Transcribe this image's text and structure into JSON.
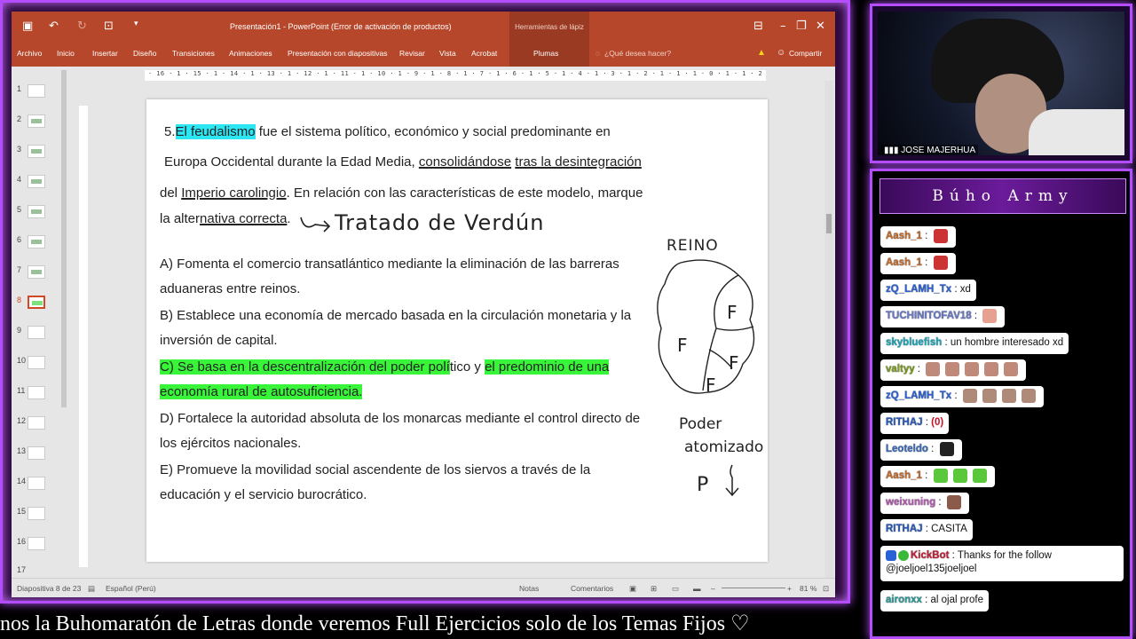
{
  "ppt": {
    "title": "Presentación1 - PowerPoint (Error de activación de productos)",
    "tools_header": "Herramientas de lápiz",
    "tabs": [
      "Archivo",
      "Inicio",
      "Insertar",
      "Diseño",
      "Transiciones",
      "Animaciones",
      "Presentación con diapositivas",
      "Revisar",
      "Vista",
      "Acrobat"
    ],
    "plumas_tab": "Plumas",
    "tell_me": "¿Qué desea hacer?",
    "share": "Compartir",
    "ruler": "· 16 · 1 · 15 · 1 · 14 · 1 · 13 · 1 · 12 · 1 · 11 · 1 · 10 · 1 · 9 · 1 · 8 · 1 · 7 · 1 · 6 · 1 · 5 · 1 · 4 · 1 · 3 · 1 · 2 · 1 · 1 · 1 · 0 · 1 · 1 · 2 · 1 · 3 · 1 · 4 · 1 · 5 · 1 · 6 · 1 · 7 · 1 · 8 · 1 · 9 · 1 · 10 · 1 · 11 · 1 · 12 · 1 · 13 · 1 · 14 · 1 · 15 · 1 · 16 ·",
    "thumbnails": [
      "1",
      "2",
      "3",
      "4",
      "5",
      "6",
      "7",
      "8",
      "9",
      "10",
      "11",
      "12",
      "13",
      "14",
      "15",
      "16",
      "17"
    ],
    "selected_slide": "8",
    "status": {
      "slide": "Diapositiva 8 de 23",
      "lang": "Español (Perú)",
      "notes": "Notas",
      "comments": "Comentarios",
      "zoom": "81 %"
    }
  },
  "slide": {
    "q_num": "5.",
    "q1_hl": "El feudalismo",
    "q1_rest": " fue el sistema político, económico y social predominante en",
    "q2a": "Europa Occidental durante la Edad Media, ",
    "q2b": "consolidándose",
    "q2c": " ",
    "q2d": "tras la desintegración",
    "q3a": "del ",
    "q3b": "Imperio carolingio",
    "q3c": ". En relación con las características de este modelo, marque",
    "q4a": "la alter",
    "q4b": "nativa correcta",
    "q4c": ".",
    "optA1": "A) Fomenta el comercio transatlántico mediante la eliminación de las barreras",
    "optA2": "aduaneras entre reinos.",
    "optB1": "B) Establece una economía de mercado basada en la circulación monetaria y la",
    "optB2": "inversión de capital.",
    "optC1a": "C) Se basa en la descentralización del poder polí",
    "optC1b": "tico y ",
    "optC1c": "el predominio de una",
    "optC2": "economía rural de autosuficiencia.",
    "optD1": "D) Fortalece la autoridad absoluta de los monarcas mediante el control directo de",
    "optD2": "los ejércitos nacionales.",
    "optE1": "E) Promueve la movilidad social ascendente de los siervos a través de la",
    "optE2": "educación y el servicio burocrático.",
    "hand_tratado": "Tratado de Verdún",
    "hand_reino": "REINO",
    "hand_f": "F",
    "hand_poder": "Poder",
    "hand_atomizado": "atomizado",
    "hand_p": "P"
  },
  "cam": {
    "name": "JOSE MAJERHUA"
  },
  "chat": {
    "title": "Búho Army",
    "messages": [
      {
        "user": "Aash_1",
        "sep": " : ",
        "text": "",
        "color": "#c46a2a"
      },
      {
        "user": "Aash_1",
        "sep": " : ",
        "text": "",
        "color": "#c46a2a"
      },
      {
        "user": "zQ_LAMH_Tx",
        "sep": " : ",
        "text": "xd",
        "color": "#2a62d6"
      },
      {
        "user": "TUCHINITOFAV18",
        "sep": " : ",
        "text": "",
        "color": "#6a78c8"
      },
      {
        "user": "skybluefish",
        "sep": " : ",
        "text": "un hombre interesado xd",
        "color": "#1aa8b8"
      },
      {
        "user": "valtyy",
        "sep": " : ",
        "text": "",
        "color": "#7a9a1a"
      },
      {
        "user": "zQ_LAMH_Tx",
        "sep": " : ",
        "text": "",
        "color": "#2a62d6"
      },
      {
        "user": "RITHAJ",
        "sep": " : ",
        "text": "(0)",
        "color": "#2a5ab8"
      },
      {
        "user": "Leoteldo",
        "sep": " : ",
        "text": "",
        "color": "#3a6ab8"
      },
      {
        "user": "Aash_1",
        "sep": " : ",
        "text": "",
        "color": "#c46a2a"
      },
      {
        "user": "weixuning",
        "sep": " : ",
        "text": "",
        "color": "#b25ab0"
      },
      {
        "user": "RITHAJ",
        "sep": " : ",
        "text": "CASITA",
        "color": "#2a5ab8"
      },
      {
        "user": "KickBot",
        "sep": " : ",
        "text": "Thanks for the follow",
        "text2": "@joeljoel135joeljoel",
        "color": "#c4203a"
      },
      {
        "user": "aironxx",
        "sep": " : ",
        "text": "al ojal profe",
        "color": "#2a9a9a"
      }
    ]
  },
  "marquee": "nos la Buhomaratón de Letras donde veremos Full Ejercicios solo de los Temas Fijos ♡",
  "colors": {
    "accent": "#b44cff",
    "ppt_red": "#b7472a",
    "highlight_cyan": "#2de6f4",
    "highlight_green": "#39f53a"
  }
}
